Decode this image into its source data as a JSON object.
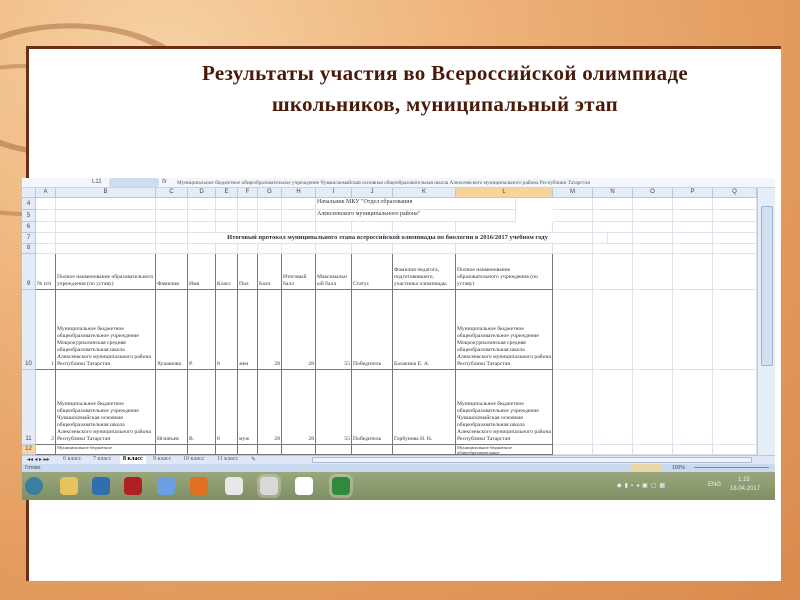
{
  "slide": {
    "title": "Результаты участия во Всероссийской олимпиаде школьников, муниципальный этап"
  },
  "excel": {
    "name_box": "L11",
    "formula": "Муниципальное бюджетное общеобразовательное учреждение Чувашскомайская основная общеобразовательная школа Алексеевского муниципального района Республики Татарстан",
    "columns": [
      "A",
      "B",
      "C",
      "D",
      "E",
      "F",
      "G",
      "H",
      "I",
      "J",
      "K",
      "L",
      "M",
      "N",
      "O",
      "P",
      "Q"
    ],
    "selected_column": "L",
    "rows": {
      "r4": {
        "num": "4",
        "text": "Начальник МКУ \"Отдел образования"
      },
      "r5": {
        "num": "5",
        "text": "Алексеевского муниципального района\""
      },
      "r6": {
        "num": "6"
      },
      "r7": {
        "num": "7",
        "text": "Итоговый протокол муниципального этапа всероссийской олимпиады по биологии в 2016/2017 учебном году"
      },
      "r8": {
        "num": "8"
      },
      "r9": {
        "num": "9",
        "headers": [
          "№ п/п",
          "Полное наименование образовательного учреждения (по уставу)",
          "Фамилия",
          "Имя",
          "Класс",
          "Пол",
          "Балл",
          "Итоговый балл",
          "Максимальный балл",
          "Статус",
          "Фамилия педагога, подготовившего, участника олимпиады",
          "Полное наименование образовательного учреждения (по уставу)"
        ]
      },
      "r10": {
        "num": "10",
        "values": [
          "1",
          "Муниципальное бюджетное общеобразовательное учреждение Мокрокурналинская средняя общеобразовательная школа Алексеевского муниципального района Республики Татарстан",
          "Хушанова",
          "Р.",
          "8",
          "жен",
          "28",
          "28",
          "55",
          "Победитель",
          "Балакина Е. А.",
          "Муниципальное бюджетное общеобразовательное учреждение Мокрокурналинская средняя общеобразовательная школа Алексеевского муниципального района Республики Татарстан"
        ]
      },
      "r11": {
        "num": "11",
        "values": [
          "2",
          "Муниципальное бюджетное общеобразовательное учреждение Чувашскомайская основная общеобразовательная школа Алексеевского муниципального района Республики Татарстан",
          "Игнатьев",
          "В.",
          "8",
          "муж",
          "28",
          "28",
          "55",
          "Победитель",
          "Горбунова Н. Н.",
          "Муниципальное бюджетное общеобразовательное учреждение Чувашскомайская основная общеобразовательная школа Алексеевского муниципального района Республики Татарстан"
        ]
      },
      "r12": {
        "num": "12",
        "values": [
          "",
          "Муниципальное бюджетное",
          "",
          "",
          "",
          "",
          "",
          "",
          "",
          "",
          "",
          "Муниципальное бюджетное общеобразовательное"
        ]
      }
    },
    "sheet_tabs": [
      "6 класс",
      "7 класс",
      "8 класс",
      "9 класс",
      "10 класс",
      "11 класс"
    ],
    "active_tab": "8 класс",
    "status": "Готово",
    "zoom": "100%"
  },
  "taskbar": {
    "lang": "ENG",
    "time": "1:15",
    "date": "18.04.2017",
    "icons": [
      "start-orb",
      "explorer",
      "control-panel",
      "power",
      "volume",
      "firefox",
      "yandex",
      "chrome",
      "yandex-browser",
      "excel"
    ]
  }
}
